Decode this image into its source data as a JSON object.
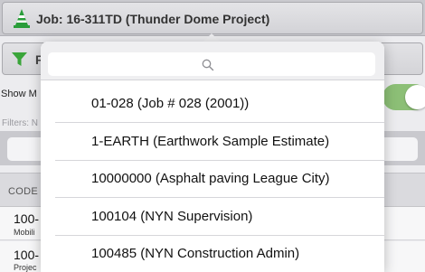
{
  "job_selector": {
    "label": "Job: 16-311TD (Thunder Dome Project)",
    "icon": "traffic-cone-icon",
    "icon_color": "#2a9d3a"
  },
  "filter_button": {
    "label": "F",
    "icon": "funnel-icon",
    "icon_color": "#3aa53a"
  },
  "show_toggle": {
    "label": "Show M",
    "on": true,
    "color": "#8cbf76"
  },
  "filters_label": "Filters: N",
  "code_header": "CODE",
  "rows": [
    {
      "code": "100-",
      "desc": "Mobili"
    },
    {
      "code": "100-",
      "desc": "Projec"
    }
  ],
  "popover": {
    "search_placeholder": "",
    "items": [
      {
        "label": "01-028 (Job # 028 (2001))"
      },
      {
        "label": "1-EARTH (Earthwork Sample Estimate)"
      },
      {
        "label": "10000000 (Asphalt paving League City)"
      },
      {
        "label": "100104 (NYN Supervision)"
      },
      {
        "label": "100485 (NYN Construction Admin)"
      }
    ]
  }
}
